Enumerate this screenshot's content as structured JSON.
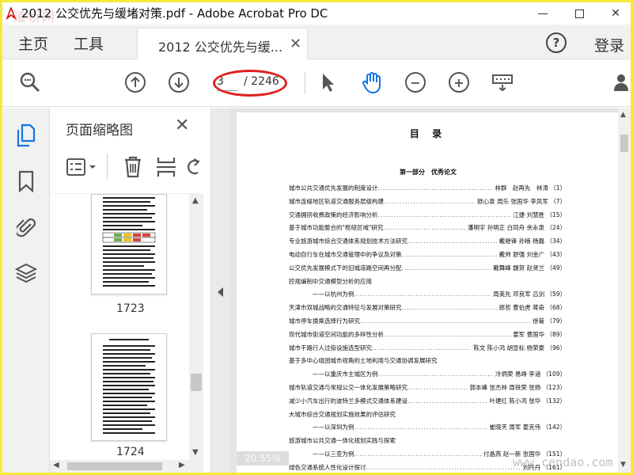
{
  "window": {
    "title": "2012 公交优先与缓堵对策.pdf - Adobe Acrobat Pro DC",
    "watermark_top_left": "道桥网",
    "controls": {
      "minimize": "",
      "maximize": "",
      "close": "✕"
    }
  },
  "menu": {
    "home": "主页",
    "tools": "工具",
    "login": "登录",
    "help": "?"
  },
  "doc_tab": {
    "label": "2012 公交优先与缓...",
    "close": "✕"
  },
  "toolbar": {
    "page_current": "3",
    "page_total": "/ 2246",
    "icons": [
      "search-zoom-icon",
      "page-up-icon",
      "page-down-icon",
      "select-arrow-icon",
      "hand-tool-icon",
      "zoom-out-icon",
      "zoom-in-icon",
      "keyboard-icon",
      "user-share-icon"
    ]
  },
  "thumbnails": {
    "title": "页面缩略图",
    "close": "✕",
    "pages": [
      {
        "label": "1723"
      },
      {
        "label": "1724"
      }
    ]
  },
  "document": {
    "toc_title": "目 录",
    "section": "第一部分　优秀论文",
    "entries": [
      {
        "title": "城市公共交通优先发展的制度设计",
        "authors": "林群　赵再先　林涛",
        "page": "（1）"
      },
      {
        "title": "城市连絡地区轨道交通服务层级构建",
        "authors": "欧心泉 周乐 张国华 李凤军",
        "page": "（7）"
      },
      {
        "title": "交通拥挤收费政策的经济影响分析",
        "authors": "江捷 刘慧胜",
        "page": "（15）"
      },
      {
        "title": "基于城市功能整合的\"枢纽区域\"研究",
        "authors": "潘明宇 孙明正 白同舟 余永泉",
        "page": "（24）"
      },
      {
        "title": "专业旅游城市综合交通体系规划技术方法研究",
        "authors": "戴继锋 孙楠 杨磊",
        "page": "（34）"
      },
      {
        "title": "电动自行车在城市交通管理中的争议及对策",
        "authors": "戴帅 舒强 刘金广",
        "page": "（43）"
      },
      {
        "title": "公交优先发展模式下的旧城道路空间再分配",
        "authors": "戴舞峰 魏贺 赵贤兰",
        "page": "（49）"
      },
      {
        "title": "控规编制中交通模型分析的应用",
        "authors": "",
        "page": ""
      },
      {
        "title": "——以杭州为例",
        "authors": "周英先 邓良军 吕剑",
        "page": "（59）",
        "indent": true
      },
      {
        "title": "天津市双城战略的交通特征与发展对策研究",
        "authors": "郎哲 曹伯虎 蒋奇",
        "page": "（68）"
      },
      {
        "title": "城市停车换乘选择行为研究",
        "authors": "徐菊",
        "page": "（79）"
      },
      {
        "title": "现代城市街道空间功能的多样性分析",
        "authors": "姜军 曹国华",
        "page": "（89）"
      },
      {
        "title": "城市干路行人过街设施选型研究",
        "authors": "陈文 陈小鸿 胡显标 杨荣豪",
        "page": "（96）"
      },
      {
        "title": "基于多中心组团城市视角的土地利用与交通协调发展研究",
        "authors": "",
        "page": ""
      },
      {
        "title": "——以重庆市主城区为例",
        "authors": "冷炳荣 易峥 李涵",
        "page": "（109）",
        "indent": true
      },
      {
        "title": "城市轨道交通与常规公交一体化发展策略研究",
        "authors": "郭本峰 张杰林 周铁荣 张扬",
        "page": "（123）"
      },
      {
        "title": "减少小汽车出行的波特兰多模式交通体系建设",
        "authors": "叶建红 陈小鸿 张华",
        "page": "（132）"
      },
      {
        "title": "大城市综合交通规划实施效果的评估研究",
        "authors": "",
        "page": ""
      },
      {
        "title": "——以深圳为例",
        "authors": "崔晓天 周军 姜克伟",
        "page": "（142）",
        "indent": true
      },
      {
        "title": "旅游城市公共交通一体化规划实践与探索",
        "authors": "",
        "page": ""
      },
      {
        "title": "——以三亚为例",
        "authors": "付晶燕 赵一新 张国华",
        "page": "（151）",
        "indent": true
      },
      {
        "title": "绿色交通系统人性化设计探讨",
        "authors": "刘丹丹",
        "page": "（161）"
      }
    ],
    "zoom": "20.55%",
    "watermark_bottom_right": "www.cendao.com"
  }
}
